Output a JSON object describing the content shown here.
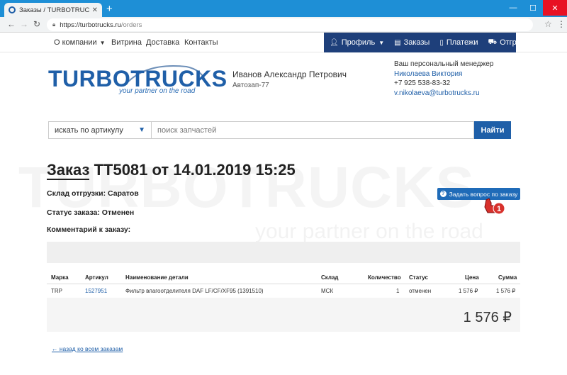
{
  "browser": {
    "tab_title": "Заказы / TURBOTRUCKS — зап",
    "new_tab": "+",
    "url_host": "https://turbotrucks.ru",
    "url_path": "/orders"
  },
  "nav": {
    "about": "О компании",
    "showcase": "Витрина",
    "delivery": "Доставка",
    "contacts": "Контакты"
  },
  "userbar": {
    "profile": "Профиль",
    "orders": "Заказы",
    "payments": "Платежи",
    "shipments": "Отгрузки"
  },
  "logo": {
    "word": "TURBOTRUCKS",
    "tagline": "your partner on the road"
  },
  "user": {
    "name": "Иванов Александр Петрович",
    "city": "Автозап-77"
  },
  "manager": {
    "caption": "Ваш персональный менеджер",
    "name": "Николаева Виктория",
    "phone": "+7 925 538-83-32",
    "email": "v.nikolaeva@turbotrucks.ru"
  },
  "search": {
    "mode": "искать по артикулу",
    "placeholder": "поиск запчастей",
    "button": "Найти"
  },
  "watermark": {
    "big": "TURBOTRUCKS",
    "small": "your partner on the road"
  },
  "order": {
    "title_prefix": "Заказ",
    "title_rest": " ТТ5081 от 14.01.2019 15:25",
    "warehouse": "Склад отгрузки: Саратов",
    "status": "Статус заказа: Отменен",
    "comment": "Комментарий к заказу:",
    "ask_button": "Задать вопрос по заказу",
    "hand_badge": "1"
  },
  "table": {
    "headers": {
      "brand": "Марка",
      "article": "Артикул",
      "name": "Наименование детали",
      "warehouse": "Склад",
      "qty": "Количество",
      "status": "Статус",
      "price": "Цена",
      "sum": "Сумма"
    },
    "rows": [
      {
        "brand": "TRP",
        "article": "1527951",
        "name": "Фильтр влагоотделителя DAF LF/CF/XF95 (1391510)",
        "warehouse": "МСК",
        "qty": "1",
        "status": "отменен",
        "price": "1 576 ₽",
        "sum": "1 576 ₽"
      }
    ],
    "total": "1 576 ₽"
  },
  "back_link": "← назад ко всем заказам",
  "colors": {
    "brand_blue": "#1f5fa8",
    "userbar": "#1e3f7a",
    "titlebar": "#1e8fd6"
  }
}
